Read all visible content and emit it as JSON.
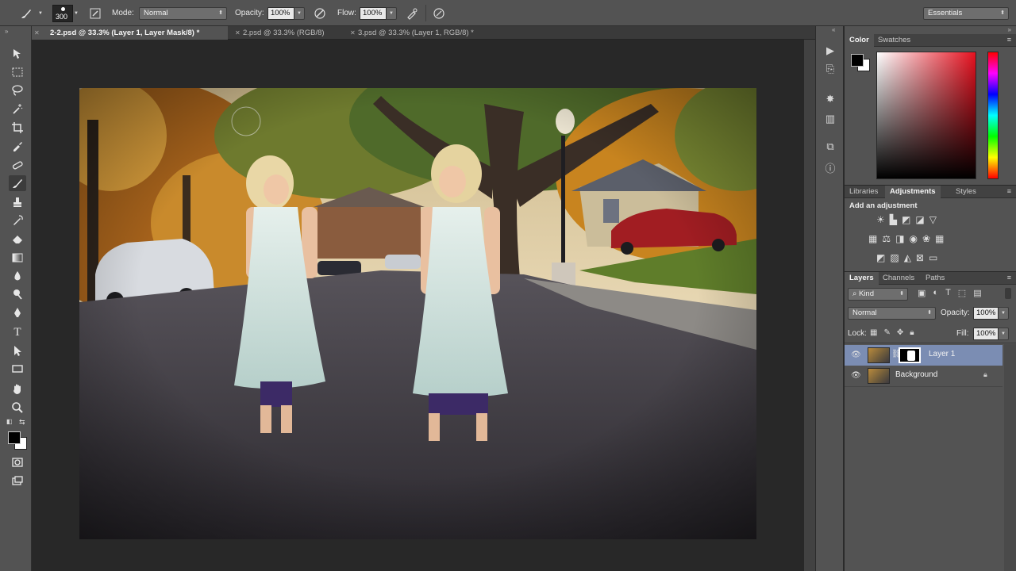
{
  "options_bar": {
    "brush_size": "300",
    "mode_label": "Mode:",
    "mode_value": "Normal",
    "opacity_label": "Opacity:",
    "opacity_value": "100%",
    "flow_label": "Flow:",
    "flow_value": "100%",
    "workspace": "Essentials"
  },
  "tabs": [
    {
      "label": "2-2.psd @ 33.3% (Layer 1, Layer Mask/8) *",
      "active": true
    },
    {
      "label": "2.psd @ 33.3% (RGB/8)",
      "active": false
    },
    {
      "label": "3.psd @ 33.3% (Layer 1, RGB/8) *",
      "active": false
    }
  ],
  "panels": {
    "color": {
      "tabs": [
        "Color",
        "Swatches"
      ]
    },
    "adjustments": {
      "tabs": [
        "Libraries",
        "Adjustments",
        "Styles"
      ],
      "heading": "Add an adjustment"
    },
    "layers": {
      "tabs": [
        "Layers",
        "Channels",
        "Paths"
      ],
      "filter_kind": "Kind",
      "blend_mode": "Normal",
      "opacity_label": "Opacity:",
      "opacity_value": "100%",
      "lock_label": "Lock:",
      "fill_label": "Fill:",
      "fill_value": "100%",
      "items": [
        {
          "name": "Layer 1",
          "selected": true
        },
        {
          "name": "Background",
          "selected": false
        }
      ]
    }
  },
  "colors": {
    "foreground": "#000000",
    "background": "#ffffff",
    "selection_accent": "#7b8db3"
  }
}
